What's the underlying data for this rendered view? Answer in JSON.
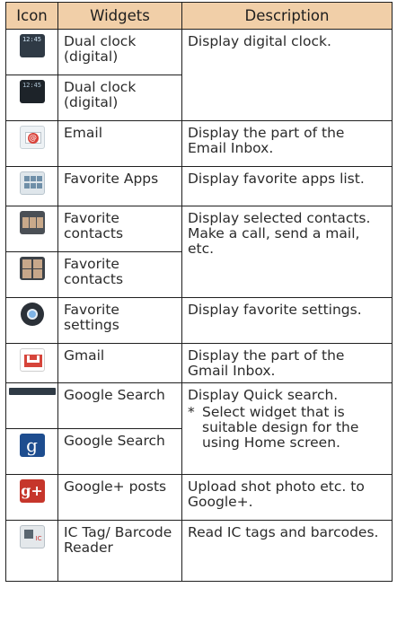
{
  "headers": {
    "icon": "Icon",
    "widgets": "Widgets",
    "description": "Description"
  },
  "rows": [
    {
      "widget": "Dual clock (digital)",
      "icon": "dual-clock-digital-icon",
      "clock_text": "12:45"
    },
    {
      "widget": "Dual clock (digital)",
      "icon": "dual-clock-digital-dark-icon",
      "clock_text": "12:45"
    },
    {
      "widget": "Email",
      "icon": "email-icon",
      "description": "Display the part of the Email Inbox."
    },
    {
      "widget": "Favorite Apps",
      "icon": "favorite-apps-icon",
      "description": "Display favorite apps list."
    },
    {
      "widget": "Favorite contacts",
      "icon": "favorite-contacts-icon"
    },
    {
      "widget": "Favorite contacts",
      "icon": "favorite-contacts-grid-icon"
    },
    {
      "widget": "Favorite settings",
      "icon": "settings-gear-icon",
      "description": "Display favorite settings."
    },
    {
      "widget": "Gmail",
      "icon": "gmail-icon",
      "description": "Display the part of the Gmail Inbox."
    },
    {
      "widget": "Google Search",
      "icon": "google-search-bar-icon"
    },
    {
      "widget": "Google Search",
      "icon": "google-search-g-icon"
    },
    {
      "widget": "Google+ posts",
      "icon": "google-plus-icon",
      "description": "Upload shot photo etc. to Google+."
    },
    {
      "widget": "IC Tag/ Barcode Reader",
      "icon": "ic-tag-barcode-icon",
      "description": "Read IC tags and barcodes."
    }
  ],
  "merged": {
    "dual_clock": "Display digital clock.",
    "favorite_contacts": "Display selected contacts. Make a call, send a mail, etc.",
    "google_search": "Display Quick search.",
    "google_search_note_mark": "*",
    "google_search_note": "Select widget that is suitable design for the using Home screen."
  },
  "icon_glyphs": {
    "google_g": "g",
    "google_plus": "g+",
    "email_at": "@"
  }
}
